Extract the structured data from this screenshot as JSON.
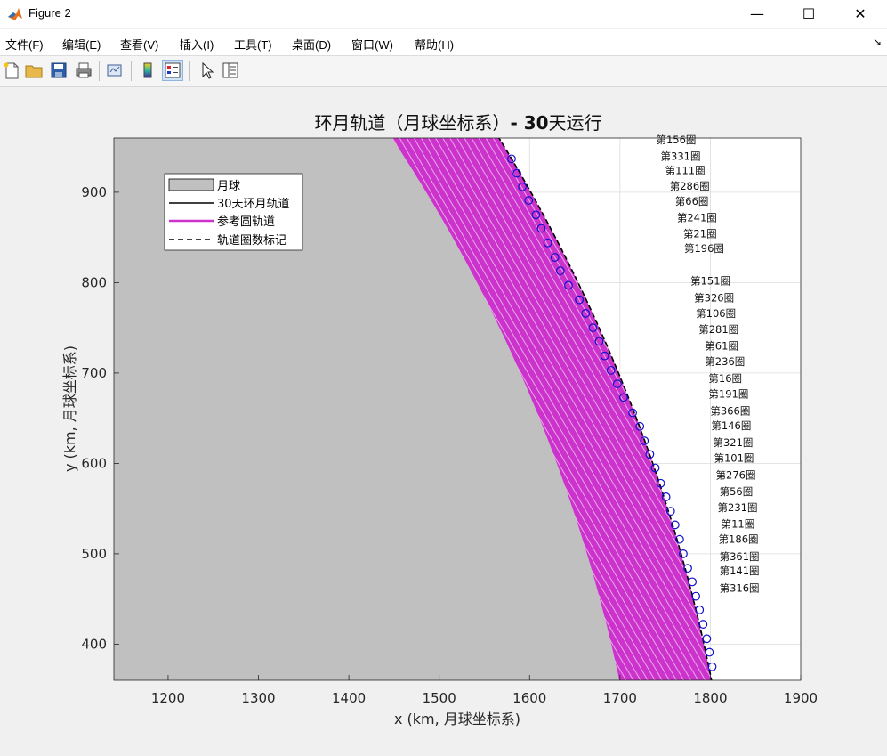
{
  "window": {
    "title": "Figure 2"
  },
  "window_controls": {
    "minimize": "—",
    "maximize": "☐",
    "close": "✕"
  },
  "menu": {
    "items": [
      "文件(F)",
      "编辑(E)",
      "查看(V)",
      "插入(I)",
      "工具(T)",
      "桌面(D)",
      "窗口(W)",
      "帮助(H)"
    ],
    "expand_glyph": "↘"
  },
  "toolbar": {
    "icons": [
      "new-figure-icon",
      "open-file-icon",
      "save-icon",
      "print-icon",
      "link-plot-icon",
      "colorbar-icon",
      "legend-icon",
      "pointer-icon",
      "property-inspector-icon"
    ]
  },
  "colors": {
    "moon": "#c0c0c0",
    "orbit_30day": "#000000",
    "reference_orbit": "#cc33cc",
    "marker": "#1010cc",
    "grid": "#dcdcdc"
  },
  "chart_data": {
    "type": "line",
    "title_cn_1": "环月轨道（月球坐标系）",
    "title_dash": "- ",
    "title_num": "30",
    "title_cn_2": "天运行",
    "xlabel": "x (km, 月球坐标系)",
    "ylabel": "y (km, 月球坐标系)",
    "xlim": [
      1140,
      1900
    ],
    "ylim": [
      360,
      960
    ],
    "xticks": [
      1200,
      1300,
      1400,
      1500,
      1600,
      1700,
      1800,
      1900
    ],
    "yticks": [
      400,
      500,
      600,
      700,
      800,
      900
    ],
    "grid": true,
    "legend_position": "top-left",
    "legend": [
      "月球",
      "30天环月轨道",
      "参考圆轨道",
      "轨道圈数标记"
    ],
    "moon_radius_km": 1737,
    "reference_orbit_radius_range_km": [
      1737,
      1837
    ],
    "orbit_outer_radius_km": 1837,
    "marker_points": [
      [
        1580,
        937
      ],
      [
        1586,
        921
      ],
      [
        1592,
        906
      ],
      [
        1599,
        891
      ],
      [
        1607,
        875
      ],
      [
        1613,
        860
      ],
      [
        1620,
        844
      ],
      [
        1628,
        828
      ],
      [
        1634,
        813
      ],
      [
        1643,
        797
      ],
      [
        1655,
        781
      ],
      [
        1662,
        766
      ],
      [
        1670,
        750
      ],
      [
        1677,
        735
      ],
      [
        1683,
        719
      ],
      [
        1690,
        703
      ],
      [
        1697,
        688
      ],
      [
        1704,
        673
      ],
      [
        1714,
        656
      ],
      [
        1722,
        641
      ],
      [
        1727,
        625
      ],
      [
        1733,
        610
      ],
      [
        1739,
        595
      ],
      [
        1745,
        578
      ],
      [
        1751,
        563
      ],
      [
        1756,
        547
      ],
      [
        1761,
        532
      ],
      [
        1766,
        516
      ],
      [
        1770,
        500
      ],
      [
        1775,
        484
      ],
      [
        1780,
        469
      ],
      [
        1784,
        453
      ],
      [
        1788,
        438
      ],
      [
        1792,
        422
      ],
      [
        1796,
        406
      ],
      [
        1799,
        391
      ],
      [
        1802,
        375
      ]
    ],
    "annotations": [
      {
        "text": "第156圈",
        "x": 1740,
        "y": 954
      },
      {
        "text": "第331圈",
        "x": 1745,
        "y": 936
      },
      {
        "text": "第111圈",
        "x": 1750,
        "y": 920
      },
      {
        "text": "第286圈",
        "x": 1755,
        "y": 903
      },
      {
        "text": "第66圈",
        "x": 1761,
        "y": 886
      },
      {
        "text": "第241圈",
        "x": 1763,
        "y": 868
      },
      {
        "text": "第21圈",
        "x": 1770,
        "y": 850
      },
      {
        "text": "第196圈",
        "x": 1771,
        "y": 834
      },
      {
        "text": "第151圈",
        "x": 1778,
        "y": 798
      },
      {
        "text": "第326圈",
        "x": 1782,
        "y": 779
      },
      {
        "text": "第106圈",
        "x": 1784,
        "y": 762
      },
      {
        "text": "第281圈",
        "x": 1787,
        "y": 744
      },
      {
        "text": "第61圈",
        "x": 1794,
        "y": 726
      },
      {
        "text": "第236圈",
        "x": 1794,
        "y": 709
      },
      {
        "text": "第16圈",
        "x": 1798,
        "y": 690
      },
      {
        "text": "第191圈",
        "x": 1798,
        "y": 673
      },
      {
        "text": "第366圈",
        "x": 1800,
        "y": 654
      },
      {
        "text": "第146圈",
        "x": 1801,
        "y": 638
      },
      {
        "text": "第321圈",
        "x": 1803,
        "y": 619
      },
      {
        "text": "第101圈",
        "x": 1804,
        "y": 602
      },
      {
        "text": "第276圈",
        "x": 1806,
        "y": 583
      },
      {
        "text": "第56圈",
        "x": 1810,
        "y": 565
      },
      {
        "text": "第231圈",
        "x": 1808,
        "y": 547
      },
      {
        "text": "第11圈",
        "x": 1812,
        "y": 529
      },
      {
        "text": "第186圈",
        "x": 1809,
        "y": 512
      },
      {
        "text": "第361圈",
        "x": 1810,
        "y": 493
      },
      {
        "text": "第141圈",
        "x": 1810,
        "y": 477
      },
      {
        "text": "第316圈",
        "x": 1810,
        "y": 458
      }
    ]
  }
}
